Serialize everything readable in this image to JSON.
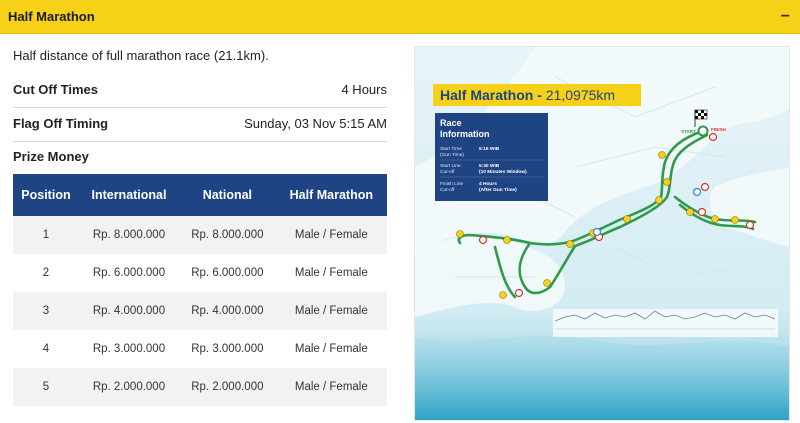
{
  "accordion": {
    "title": "Half Marathon",
    "toggle": "−"
  },
  "description": "Half distance of full marathon race (21.1km).",
  "cutoff": {
    "label": "Cut Off Times",
    "value": "4 Hours"
  },
  "flagoff": {
    "label": "Flag Off Timing",
    "value": "Sunday, 03 Nov 5:15 AM"
  },
  "prize": {
    "title": "Prize Money",
    "headers": [
      "Position",
      "International",
      "National",
      "Half Marathon"
    ],
    "rows": [
      [
        "1",
        "Rp. 8.000.000",
        "Rp. 8.000.000",
        "Male / Female"
      ],
      [
        "2",
        "Rp. 6.000.000",
        "Rp. 6.000.000",
        "Male / Female"
      ],
      [
        "3",
        "Rp. 4.000.000",
        "Rp. 4.000.000",
        "Male / Female"
      ],
      [
        "4",
        "Rp. 3.000.000",
        "Rp. 3.000.000",
        "Male / Female"
      ],
      [
        "5",
        "Rp. 2.000.000",
        "Rp. 2.000.000",
        "Male / Female"
      ]
    ]
  },
  "map": {
    "title_prefix": "Half Marathon - ",
    "title_distance": "21,0975km",
    "race_info": {
      "title_line1": "Race",
      "title_line2": "Information",
      "items": [
        {
          "label1": "Start Time",
          "label2": "(Gun Time)",
          "value1": "5:15 WIB",
          "value2": ""
        },
        {
          "label1": "Start Line",
          "label2": "Cut-off",
          "value1": "5:30 WIB",
          "value2": "(10 Minutes Window)"
        },
        {
          "label1": "Finish Line",
          "label2": "Cut-off",
          "value1": "4 Hours",
          "value2": "(After Gun Time)"
        }
      ]
    },
    "start_label": "START",
    "finish_label": "FINISH",
    "colors": {
      "route": "#2f9a4a",
      "sea": "#d9eef6",
      "land": "#eef6f9",
      "title_bg": "#f7d117",
      "info_bg": "#1f4483"
    }
  }
}
